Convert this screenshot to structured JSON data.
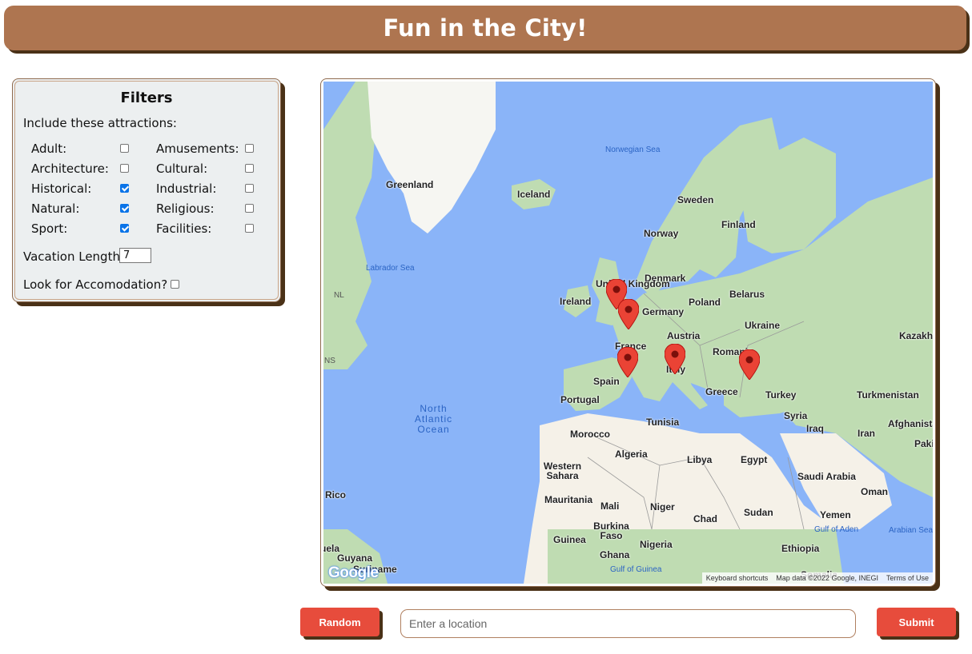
{
  "header": {
    "title": "Fun in the City!"
  },
  "filters": {
    "title": "Filters",
    "include_label": "Include these attractions:",
    "attractions": [
      {
        "label": "Adult:",
        "checked": false
      },
      {
        "label": "Amusements:",
        "checked": false
      },
      {
        "label": "Architecture:",
        "checked": false
      },
      {
        "label": "Cultural:",
        "checked": false
      },
      {
        "label": "Historical:",
        "checked": true
      },
      {
        "label": "Industrial:",
        "checked": false
      },
      {
        "label": "Natural:",
        "checked": true
      },
      {
        "label": "Religious:",
        "checked": false
      },
      {
        "label": "Sport:",
        "checked": true
      },
      {
        "label": "Facilities:",
        "checked": false
      }
    ],
    "vacation_length_label": "Vacation Length:",
    "vacation_length_value": "7",
    "accommodation_label": "Look for Accomodation?",
    "accommodation_checked": false
  },
  "map": {
    "country_labels": [
      "Greenland",
      "Iceland",
      "Sweden",
      "Finland",
      "Norway",
      "Denmark",
      "United Kingdom",
      "Ireland",
      "Germany",
      "Poland",
      "Belarus",
      "Ukraine",
      "Austria",
      "France",
      "Romania",
      "Italy",
      "Spain",
      "Portugal",
      "Greece",
      "Turkey",
      "Kazakhstan",
      "Tunisia",
      "Syria",
      "Iraq",
      "Iran",
      "Afghanistan",
      "Turkmenistan",
      "Pakistan",
      "Morocco",
      "Algeria",
      "Libya",
      "Egypt",
      "Western Sahara",
      "Saudi Arabia",
      "Oman",
      "Mauritania",
      "Mali",
      "Niger",
      "Chad",
      "Sudan",
      "Yemen",
      "Burkina Faso",
      "Guinea",
      "Nigeria",
      "Ghana",
      "Ethiopia",
      "Puerto Rico",
      "Venezuela",
      "Guyana",
      "Suriname",
      "Somalia"
    ],
    "sea_labels": [
      "Norwegian Sea",
      "Labrador Sea",
      "Gulf of Aden",
      "Arabian Sea",
      "Gulf of Guinea"
    ],
    "ocean_label": "North Atlantic Ocean",
    "region_labels": [
      "NL",
      "NS"
    ],
    "attribution": {
      "shortcuts": "Keyboard shortcuts",
      "data": "Map data ©2022 Google, INEGI",
      "terms": "Terms of Use"
    },
    "logo": "Google",
    "marker_color": "#ea4335"
  },
  "controls": {
    "random_label": "Random",
    "submit_label": "Submit",
    "location_placeholder": "Enter a location"
  },
  "colors": {
    "header_bg": "#ae7550",
    "shadow": "#4a3117",
    "button_bg": "#e74c3c",
    "water": "#8ab4f8",
    "land": "#bfdcb2",
    "desert": "#f5f1e8"
  }
}
